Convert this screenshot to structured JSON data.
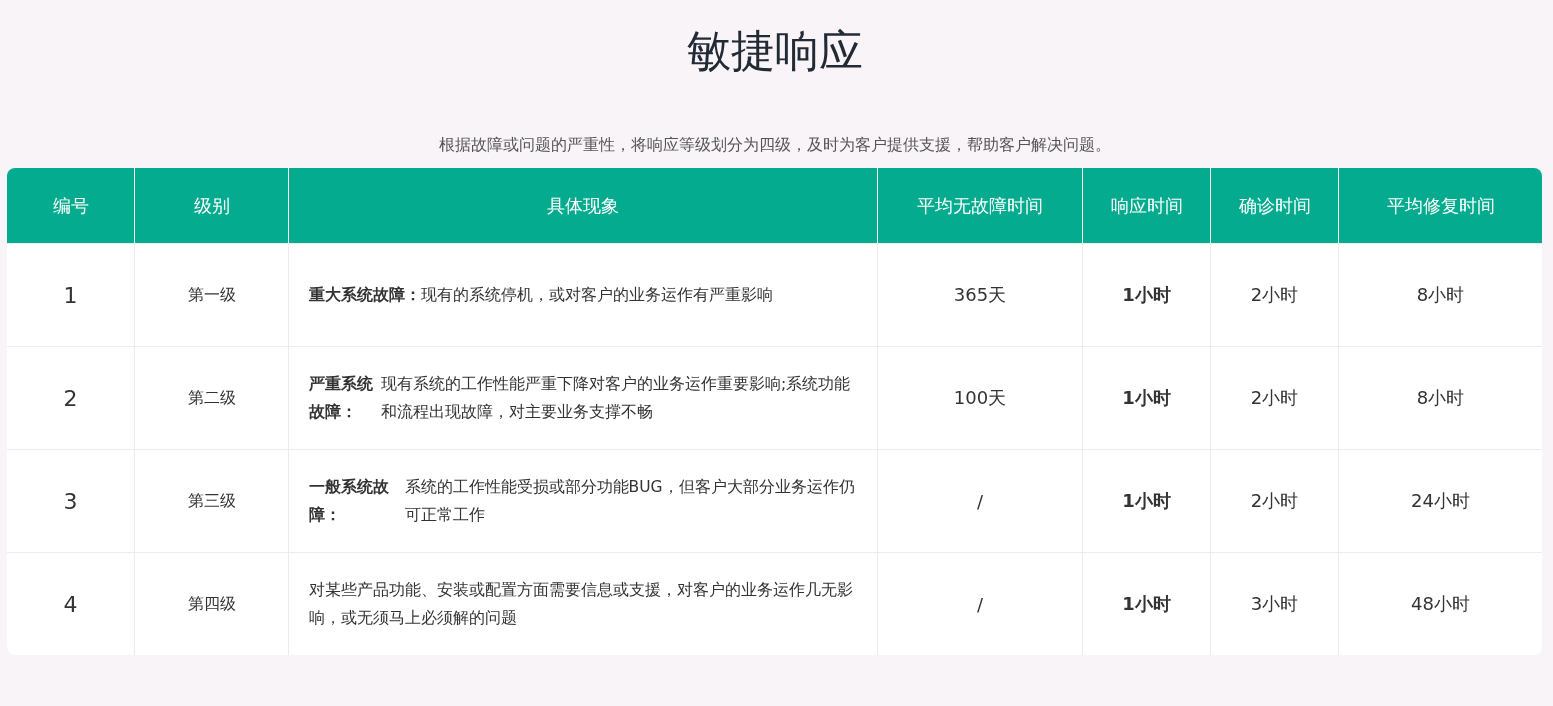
{
  "title": "敏捷响应",
  "subtitle": "根据故障或问题的严重性，将响应等级划分为四级，及时为客户提供支援，帮助客户解决问题。",
  "table": {
    "columns": [
      "编号",
      "级别",
      "具体现象",
      "平均无故障时间",
      "响应时间",
      "确诊时间",
      "平均修复时间"
    ],
    "rows": [
      {
        "number": "1",
        "level": "第一级",
        "description": "**重大系统故障：**现有的系统停机，或对客户的业务运作有严重影响",
        "mtbf": "365天",
        "response_time": "1小时",
        "diagnosis_time": "2小时",
        "repair_time": "8小时"
      },
      {
        "number": "2",
        "level": "第二级",
        "description": "**严重系统故障：**现有系统的工作性能严重下降对客户的业务运作重要影响;系统功能和流程出现故障，对主要业务支撑不畅",
        "mtbf": "100天",
        "response_time": "1小时",
        "diagnosis_time": "2小时",
        "repair_time": "8小时"
      },
      {
        "number": "3",
        "level": "第三级",
        "description": "**一般系统故障：**系统的工作性能受损或部分功能BUG，但客户大部分业务运作仍可正常工作",
        "mtbf": "/",
        "response_time": "1小时",
        "diagnosis_time": "2小时",
        "repair_time": "24小时"
      },
      {
        "number": "4",
        "level": "第四级",
        "description": "对某些产品功能、安装或配置方面需要信息或支援，对客户的业务运作几无影响，或无须马上必须解的问题",
        "mtbf": "/",
        "response_time": "1小时",
        "diagnosis_time": "3小时",
        "repair_time": "48小时"
      }
    ]
  }
}
